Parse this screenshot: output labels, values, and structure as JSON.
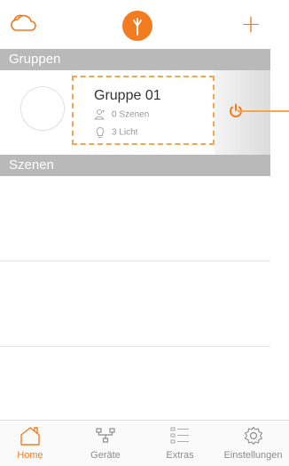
{
  "top_bar": {
    "icons": [
      "cloud-icon",
      "logo-icon",
      "plus-icon"
    ],
    "plus_label": "+",
    "accent_color": "#f47c20"
  },
  "sections": {
    "gruppen": "Gruppen",
    "szenen": "Szenen"
  },
  "group": {
    "name": "Gruppe 01",
    "scenes": "0 Szenen",
    "lights": "3 Licht"
  },
  "tabs": [
    {
      "label": "Home",
      "icon": "home-icon",
      "active": true
    },
    {
      "label": "Geräte",
      "icon": "devices-icon",
      "active": false
    },
    {
      "label": "Extras",
      "icon": "list-icon",
      "active": false
    },
    {
      "label": "Einstellungen",
      "icon": "gear-icon",
      "active": false
    }
  ],
  "colors": {
    "accent": "#f47c20",
    "section_header": "#b9b9b9",
    "highlight": "#f5a64f"
  }
}
